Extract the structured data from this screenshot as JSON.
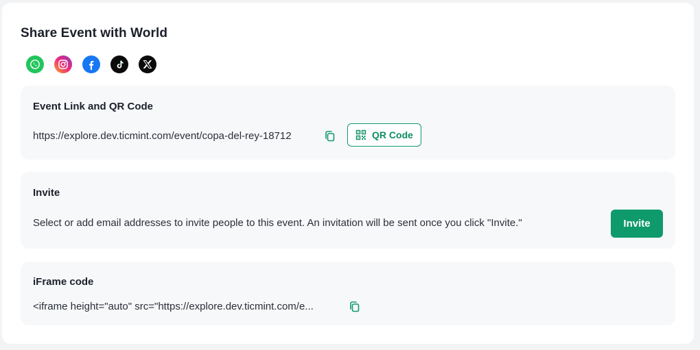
{
  "page": {
    "title": "Share Event with World"
  },
  "socials": [
    {
      "name": "whatsapp-icon"
    },
    {
      "name": "instagram-icon"
    },
    {
      "name": "facebook-icon"
    },
    {
      "name": "tiktok-icon"
    },
    {
      "name": "x-icon"
    }
  ],
  "event_link": {
    "title": "Event Link and QR Code",
    "url": "https://explore.dev.ticmint.com/event/copa-del-rey-18712",
    "qr_button_label": "QR Code"
  },
  "invite": {
    "title": "Invite",
    "description": "Select or add email addresses to invite people to this event. An invitation will be sent once you click \"Invite.\"",
    "button_label": "Invite"
  },
  "iframe": {
    "title": "iFrame code",
    "code": "<iframe height=\"auto\" src=\"https://explore.dev.ticmint.com/e..."
  },
  "colors": {
    "accent": "#0f9a6c",
    "section_bg": "#f7f8fa",
    "page_bg": "#f2f3f5"
  }
}
